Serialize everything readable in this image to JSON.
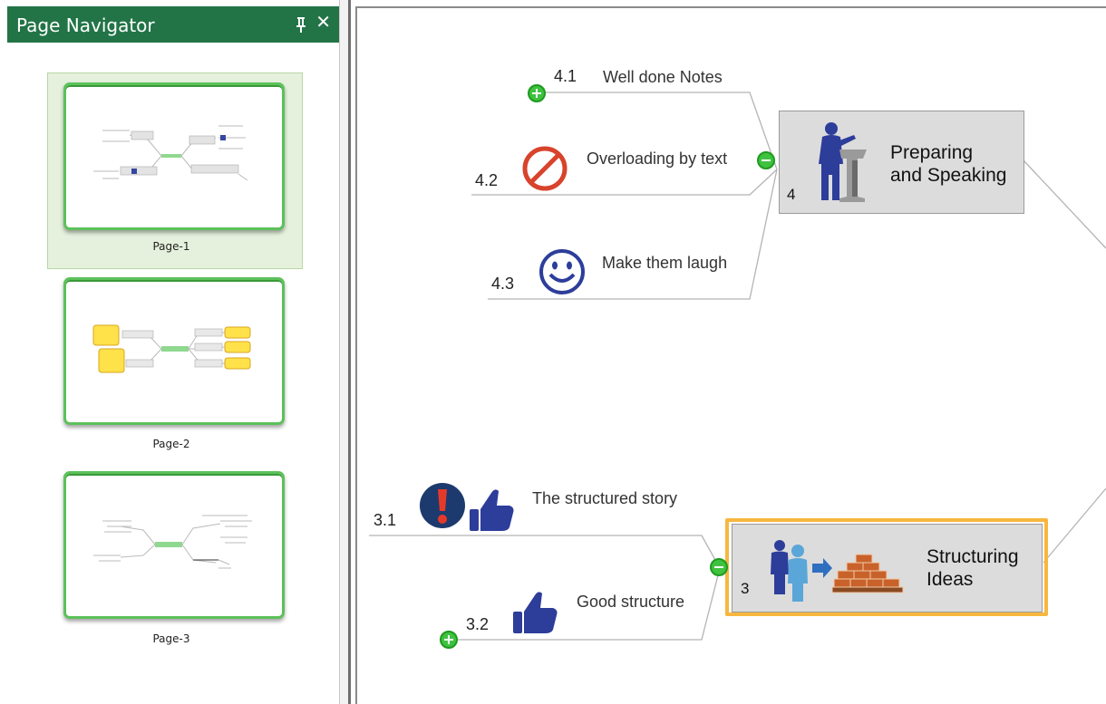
{
  "navigator": {
    "title": "Page Navigator",
    "pages": [
      {
        "label": "Page-1",
        "selected": true
      },
      {
        "label": "Page-2",
        "selected": false
      },
      {
        "label": "Page-3",
        "selected": false
      }
    ]
  },
  "map": {
    "topic4": {
      "number": "4",
      "title_line1": "Preparing",
      "title_line2": "and Speaking",
      "icon": "speaker-at-podium-icon"
    },
    "topic3": {
      "number": "3",
      "title_line1": "Structuring",
      "title_line2": "Ideas",
      "icon": "people-to-bricks-icon",
      "selected": true
    },
    "branches": [
      {
        "number": "4.1",
        "label": "Well done Notes",
        "icon": "",
        "expand": "plus"
      },
      {
        "number": "4.2",
        "label": "Overloading by text",
        "icon": "prohibited-icon",
        "expand": ""
      },
      {
        "number": "4.3",
        "label": "Make them laugh",
        "icon": "smiley-icon",
        "expand": ""
      },
      {
        "number": "3.1",
        "label": "The structured story",
        "icon": "exclamation-and-thumbs-up-icons",
        "expand": ""
      },
      {
        "number": "3.2",
        "label": "Good structure",
        "icon": "thumbs-up-icon",
        "expand": "plus"
      }
    ]
  },
  "colors": {
    "header_green": "#227447",
    "thumb_border": "#5cc15a",
    "selection_orange": "#f7b73e",
    "toggle_green": "#3fc23f"
  }
}
